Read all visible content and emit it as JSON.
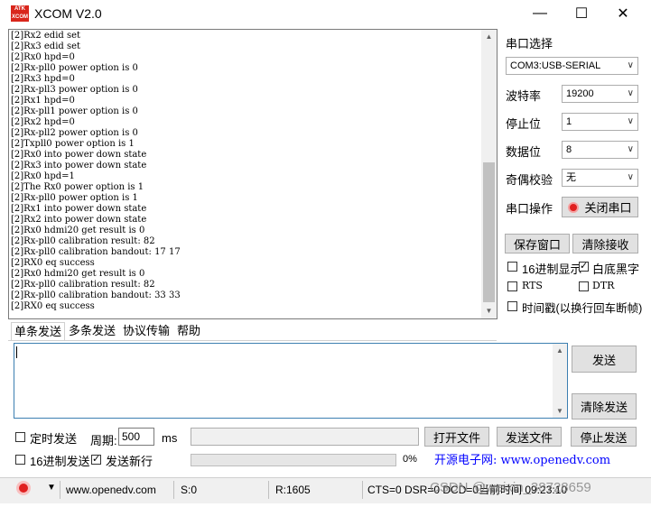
{
  "window": {
    "logo_text": "ATK XCOM",
    "title": "XCOM V2.0",
    "minimize": "—",
    "maximize": "☐",
    "close": "✕"
  },
  "receive": {
    "lines": [
      "[2]Rx2 edid set",
      "[2]Rx3 edid set",
      "[2]Rx0 hpd=0",
      "[2]Rx-pll0 power option is 0",
      "[2]Rx3 hpd=0",
      "[2]Rx-pll3 power option is 0",
      "[2]Rx1 hpd=0",
      "[2]Rx-pll1 power option is 0",
      "[2]Rx2 hpd=0",
      "[2]Rx-pll2 power option is 0",
      "[2]Txpll0 power option is 1",
      "[2]Rx0 into power down state",
      "[2]Rx3 into power down state",
      "[2]Rx0 hpd=1",
      "[2]The Rx0 power option is 1",
      "[2]Rx-pll0 power option is 1",
      "[2]Rx1 into power down state",
      "[2]Rx2 into power down state",
      "[2]Rx0 hdmi20 get result is 0",
      "[2]Rx-pll0 calibration result: 82",
      "[2]Rx-pll0 calibration bandout: 17 17",
      "[2]RX0 eq success",
      "[2]Rx0 hdmi20 get result is 0",
      "[2]Rx-pll0 calibration result: 82",
      "[2]Rx-pll0 calibration bandout: 33 33",
      "[2]RX0 eq success"
    ]
  },
  "panel": {
    "port_select_label": "串口选择",
    "port_value": "COM3:USB-SERIAL",
    "baud_label": "波特率",
    "baud_value": "19200",
    "stopbits_label": "停止位",
    "stopbits_value": "1",
    "databits_label": "数据位",
    "databits_value": "8",
    "parity_label": "奇偶校验",
    "parity_value": "无",
    "port_op_label": "串口操作",
    "close_port_button": "关闭串口",
    "save_window_button": "保存窗口",
    "clear_receive_button": "清除接收",
    "hex_display_label": "16进制显示",
    "white_bg_label": "白底黑字",
    "rts_label": "RTS",
    "dtr_label": "DTR",
    "timestamp_label": "时间戳(以换行回车断帧)"
  },
  "tabs": [
    "单条发送",
    "多条发送",
    "协议传输",
    "帮助"
  ],
  "send": {
    "send_button": "发送",
    "clear_send_button": "清除发送",
    "timed_send_label": "定时发送",
    "period_label": "周期:",
    "period_value": "500",
    "period_unit": "ms",
    "open_file_button": "打开文件",
    "send_file_button": "发送文件",
    "stop_send_button": "停止发送",
    "hex_send_label": "16进制发送",
    "send_newline_label": "发送新行",
    "progress_text": "0%",
    "progress_fraction": 0,
    "link_text": "开源电子网: www.openedv.com"
  },
  "status": {
    "url": "www.openedv.com",
    "sent": "S:0",
    "received": "R:1605",
    "signals": "CTS=0 DSR=0 DCD=0",
    "time": "当前时间 09:23:10",
    "watermark": "CSDN @weixin_38728659"
  },
  "colors": {
    "accent_blue": "#3c7fb1",
    "link_blue": "#0000ff",
    "logo_red": "#d9261c",
    "led_red": "#e02020"
  }
}
